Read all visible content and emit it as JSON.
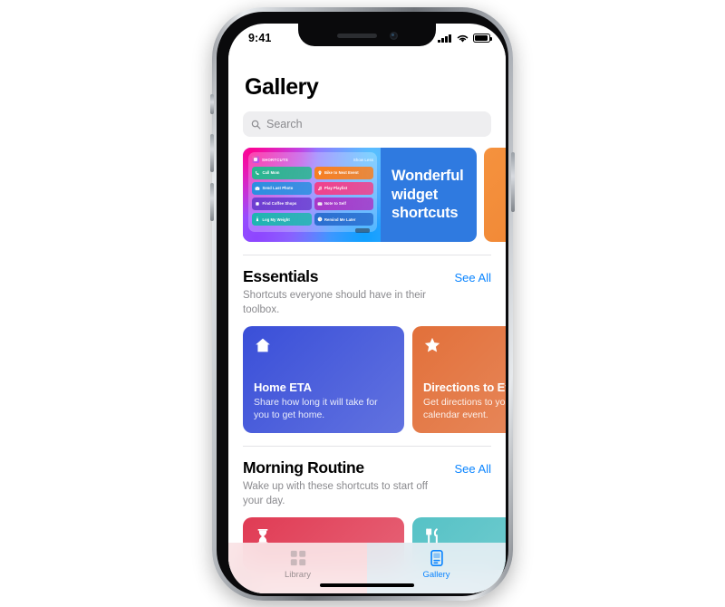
{
  "device": {
    "status_bar": {
      "time": "9:41",
      "signal_icon": "cellular-signal-icon",
      "wifi_icon": "wifi-icon",
      "battery_icon": "battery-icon"
    },
    "home_indicator": "home-indicator"
  },
  "app": {
    "page_title": "Gallery",
    "search": {
      "placeholder": "Search",
      "icon": "search-icon"
    }
  },
  "featured": {
    "widget_preview": {
      "app_name": "SHORTCUTS",
      "show_less_label": "Show Less",
      "tiles": [
        {
          "label": "Call Mom",
          "icon": "phone-icon",
          "color": "#27b88f"
        },
        {
          "label": "Bike to Next Event",
          "icon": "location-icon",
          "color": "#f77f20"
        },
        {
          "label": "Send Last Photo",
          "icon": "camera-icon",
          "color": "#2b8fe0"
        },
        {
          "label": "Play Playlist",
          "icon": "music-note-icon",
          "color": "#f0418c"
        },
        {
          "label": "Find Coffee Shops",
          "icon": "square-icon",
          "color": "#6c3fd0"
        },
        {
          "label": "Note to Self",
          "icon": "envelope-icon",
          "color": "#a838c8"
        },
        {
          "label": "Log My Weight",
          "icon": "scale-icon",
          "color": "#1fb6b0"
        },
        {
          "label": "Remind Me Later",
          "icon": "clock-icon",
          "color": "#2a6fd0"
        }
      ]
    },
    "headline": "Wonderful widget shortcuts",
    "headline_bg": "#2f7ae0",
    "next_card_color": "#ea7b2c"
  },
  "sections": [
    {
      "title": "Essentials",
      "see_all_label": "See All",
      "subtitle": "Shortcuts everyone should have in their toolbox.",
      "cards": [
        {
          "title": "Home ETA",
          "desc": "Share how long it will take for you to get home.",
          "icon": "house-icon",
          "color": "#3a4fd8"
        },
        {
          "title": "Directions to Event",
          "desc": "Get directions to your next calendar event.",
          "icon": "star-icon",
          "color": "#e2703a"
        }
      ]
    },
    {
      "title": "Morning Routine",
      "see_all_label": "See All",
      "subtitle": "Wake up with these shortcuts to start off your day.",
      "cards": [
        {
          "title": "",
          "desc": "",
          "icon": "hourglass-icon",
          "color": "#e03b54"
        },
        {
          "title": "",
          "desc": "",
          "icon": "utensils-icon",
          "color": "#56c2c6"
        }
      ]
    }
  ],
  "tab_bar": {
    "tabs": [
      {
        "label": "Library",
        "icon": "grid-icon",
        "active": false
      },
      {
        "label": "Gallery",
        "icon": "card-icon",
        "active": true
      }
    ]
  }
}
